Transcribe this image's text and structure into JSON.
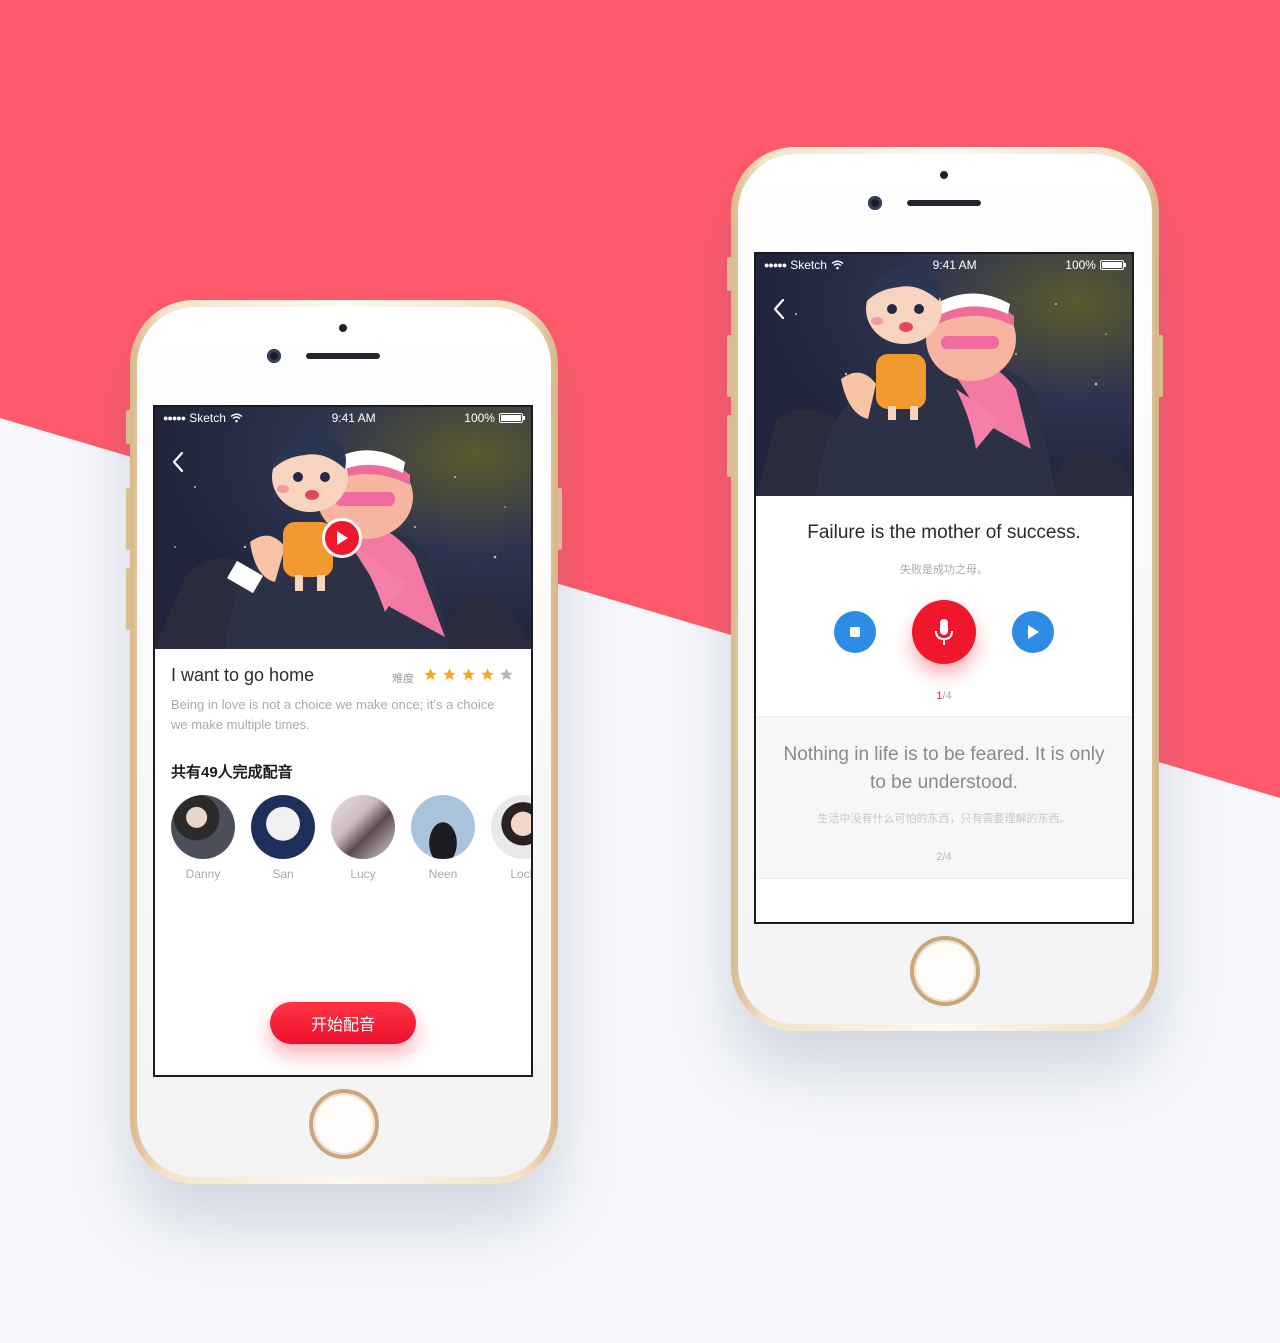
{
  "colors": {
    "accent": "#F0172C",
    "background_top": "#FF5A6B",
    "background_bottom": "#F5F7FB",
    "control_blue": "#2E8BE6",
    "star": "#F5A623"
  },
  "status_bar": {
    "carrier": "Sketch",
    "time": "9:41 AM",
    "battery": "100%",
    "signal_icon": "signal-dots-icon",
    "wifi_icon": "wifi-icon"
  },
  "detail_screen": {
    "title": "I want to go home",
    "difficulty_label": "难度",
    "difficulty_rating": 4,
    "difficulty_max": 5,
    "description": "Being in love is not a choice we make once; it’s a choice we make multiple times.",
    "participants_title": "共有49人完成配音",
    "participants": [
      {
        "name": "Danny"
      },
      {
        "name": "San"
      },
      {
        "name": "Lucy"
      },
      {
        "name": "Neen"
      },
      {
        "name": "Lock"
      }
    ],
    "start_button": "开始配音"
  },
  "recording_screen": {
    "current_sentence": "Failure is the mother of success.",
    "current_translation": "失败是成功之母。",
    "current_index": "1",
    "total_sep": "/4",
    "next_sentence": "Nothing in life is to be feared. It is only to be understood.",
    "next_translation": "生活中没有什么可怕的东西，只有需要理解的东西。",
    "next_progress": "2/4",
    "controls": [
      "stop-icon",
      "microphone-icon",
      "play-icon"
    ]
  }
}
